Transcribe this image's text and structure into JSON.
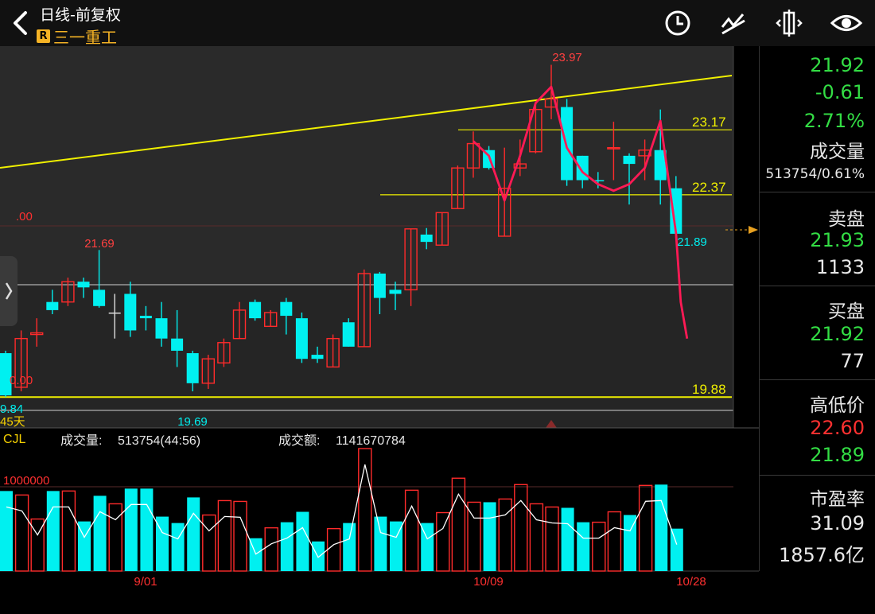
{
  "header": {
    "title": "日线-前复权",
    "badge": "R",
    "stock_name": "三一重工",
    "icons": [
      "back-arrow-icon",
      "clock-icon",
      "draw-line-icon",
      "crosshair-icon",
      "eye-icon"
    ]
  },
  "colors": {
    "up": "#ff2b2b",
    "down": "#00f0f0",
    "trendline": "#f0f000",
    "ma_line": "#ff1a55",
    "price_green": "#33dd44",
    "price_red": "#ff3030"
  },
  "chart_data": [
    {
      "type": "candlestick",
      "title": "日线-前复权",
      "ylim": [
        19.5,
        24.2
      ],
      "price_labels": {
        "high": "23.97",
        "left_high": "21.69",
        "low": "19.69",
        "last": "21.89",
        "left_low": "9.84",
        "left_top": ".00",
        "left_bottom": "0.00"
      },
      "levels": [
        {
          "label": "23.17",
          "value": 23.17
        },
        {
          "label": "22.37",
          "value": 22.37
        },
        {
          "label": "19.88",
          "value": 19.88
        }
      ],
      "period_label": "45天",
      "candles": [
        {
          "o": 19.9,
          "c": 20.42,
          "h": 20.45,
          "l": 19.88,
          "d": "down"
        },
        {
          "o": 20.0,
          "c": 20.6,
          "h": 20.7,
          "l": 19.95,
          "d": "up"
        },
        {
          "o": 20.65,
          "c": 20.67,
          "h": 20.85,
          "l": 20.5,
          "d": "up"
        },
        {
          "o": 20.95,
          "c": 21.05,
          "h": 21.2,
          "l": 20.9,
          "d": "down"
        },
        {
          "o": 21.05,
          "c": 21.3,
          "h": 21.35,
          "l": 21.0,
          "d": "up"
        },
        {
          "o": 21.3,
          "c": 21.23,
          "h": 21.35,
          "l": 21.1,
          "d": "down"
        },
        {
          "o": 21.2,
          "c": 21.0,
          "h": 21.69,
          "l": 20.98,
          "d": "down"
        },
        {
          "o": 20.92,
          "c": 20.92,
          "h": 21.15,
          "l": 20.6,
          "d": "flat"
        },
        {
          "o": 21.15,
          "c": 20.7,
          "h": 21.3,
          "l": 20.62,
          "d": "down"
        },
        {
          "o": 20.88,
          "c": 20.85,
          "h": 21.0,
          "l": 20.7,
          "d": "down"
        },
        {
          "o": 20.85,
          "c": 20.6,
          "h": 21.05,
          "l": 20.5,
          "d": "down"
        },
        {
          "o": 20.6,
          "c": 20.45,
          "h": 20.95,
          "l": 20.25,
          "d": "down"
        },
        {
          "o": 20.05,
          "c": 20.42,
          "h": 20.45,
          "l": 19.95,
          "d": "down"
        },
        {
          "o": 20.05,
          "c": 20.35,
          "h": 20.4,
          "l": 19.98,
          "d": "up"
        },
        {
          "o": 20.3,
          "c": 20.55,
          "h": 20.6,
          "l": 20.25,
          "d": "up"
        },
        {
          "o": 20.6,
          "c": 20.95,
          "h": 21.05,
          "l": 20.6,
          "d": "up"
        },
        {
          "o": 21.05,
          "c": 20.85,
          "h": 21.08,
          "l": 20.82,
          "d": "down"
        },
        {
          "o": 20.75,
          "c": 20.92,
          "h": 20.95,
          "l": 20.75,
          "d": "up"
        },
        {
          "o": 21.05,
          "c": 20.88,
          "h": 21.1,
          "l": 20.65,
          "d": "down"
        },
        {
          "o": 20.85,
          "c": 20.35,
          "h": 20.92,
          "l": 20.3,
          "d": "down"
        },
        {
          "o": 20.35,
          "c": 20.4,
          "h": 20.5,
          "l": 20.3,
          "d": "down"
        },
        {
          "o": 20.25,
          "c": 20.6,
          "h": 20.65,
          "l": 20.25,
          "d": "up"
        },
        {
          "o": 20.8,
          "c": 20.5,
          "h": 20.85,
          "l": 20.5,
          "d": "down"
        },
        {
          "o": 20.5,
          "c": 21.4,
          "h": 21.45,
          "l": 20.5,
          "d": "up"
        },
        {
          "o": 21.4,
          "c": 21.1,
          "h": 21.42,
          "l": 20.9,
          "d": "down"
        },
        {
          "o": 21.15,
          "c": 21.2,
          "h": 21.3,
          "l": 20.95,
          "d": "down"
        },
        {
          "o": 21.2,
          "c": 21.95,
          "h": 21.95,
          "l": 21.0,
          "d": "up"
        },
        {
          "o": 21.88,
          "c": 21.79,
          "h": 21.96,
          "l": 21.7,
          "d": "down"
        },
        {
          "o": 21.75,
          "c": 22.15,
          "h": 22.15,
          "l": 21.75,
          "d": "up"
        },
        {
          "o": 22.2,
          "c": 22.7,
          "h": 22.73,
          "l": 22.2,
          "d": "up"
        },
        {
          "o": 22.7,
          "c": 23.0,
          "h": 23.15,
          "l": 22.58,
          "d": "up"
        },
        {
          "o": 22.92,
          "c": 22.7,
          "h": 22.97,
          "l": 22.68,
          "d": "down"
        },
        {
          "o": 21.86,
          "c": 22.45,
          "h": 22.95,
          "l": 21.86,
          "d": "up"
        },
        {
          "o": 22.7,
          "c": 22.75,
          "h": 23.05,
          "l": 22.6,
          "d": "up"
        },
        {
          "o": 22.9,
          "c": 23.42,
          "h": 23.48,
          "l": 22.88,
          "d": "up"
        },
        {
          "o": 23.45,
          "c": 23.55,
          "h": 23.97,
          "l": 23.3,
          "d": "up"
        },
        {
          "o": 23.45,
          "c": 22.55,
          "h": 23.55,
          "l": 22.48,
          "d": "down"
        },
        {
          "o": 22.85,
          "c": 22.55,
          "h": 22.85,
          "l": 22.45,
          "d": "down"
        },
        {
          "o": 22.55,
          "c": 22.55,
          "h": 22.65,
          "l": 22.45,
          "d": "down"
        },
        {
          "o": 22.95,
          "c": 22.95,
          "h": 23.27,
          "l": 22.55,
          "d": "up"
        },
        {
          "o": 22.85,
          "c": 22.75,
          "h": 22.88,
          "l": 22.25,
          "d": "down"
        },
        {
          "o": 22.85,
          "c": 22.92,
          "h": 23.05,
          "l": 22.55,
          "d": "up"
        },
        {
          "o": 22.92,
          "c": 22.55,
          "h": 23.42,
          "l": 22.25,
          "d": "down"
        },
        {
          "o": 22.45,
          "c": 21.89,
          "h": 22.6,
          "l": 21.89,
          "d": "down"
        }
      ]
    },
    {
      "type": "bar",
      "title": "成交量",
      "header": {
        "indicator": "CJL",
        "volume_label": "成交量:",
        "volume_value": "513754(44:56)",
        "amount_label": "成交额:",
        "amount_value": "1141670784",
        "scale_label": "1000000"
      },
      "ylim": [
        0,
        1550000
      ],
      "x_ticks": [
        "9/01",
        "10/09",
        "10/28"
      ],
      "volumes": [
        {
          "v": 1000000,
          "d": "down"
        },
        {
          "v": 950000,
          "d": "up"
        },
        {
          "v": 650000,
          "d": "up"
        },
        {
          "v": 1000000,
          "d": "down"
        },
        {
          "v": 1000000,
          "d": "up"
        },
        {
          "v": 620000,
          "d": "down"
        },
        {
          "v": 940000,
          "d": "down"
        },
        {
          "v": 840000,
          "d": "up"
        },
        {
          "v": 1030000,
          "d": "down"
        },
        {
          "v": 1030000,
          "d": "down"
        },
        {
          "v": 680000,
          "d": "down"
        },
        {
          "v": 600000,
          "d": "down"
        },
        {
          "v": 920000,
          "d": "down"
        },
        {
          "v": 700000,
          "d": "up"
        },
        {
          "v": 880000,
          "d": "up"
        },
        {
          "v": 870000,
          "d": "up"
        },
        {
          "v": 410000,
          "d": "down"
        },
        {
          "v": 540000,
          "d": "up"
        },
        {
          "v": 610000,
          "d": "down"
        },
        {
          "v": 740000,
          "d": "down"
        },
        {
          "v": 370000,
          "d": "down"
        },
        {
          "v": 530000,
          "d": "up"
        },
        {
          "v": 600000,
          "d": "down"
        },
        {
          "v": 1530000,
          "d": "up"
        },
        {
          "v": 680000,
          "d": "down"
        },
        {
          "v": 620000,
          "d": "down"
        },
        {
          "v": 1010000,
          "d": "up"
        },
        {
          "v": 600000,
          "d": "down"
        },
        {
          "v": 730000,
          "d": "up"
        },
        {
          "v": 1160000,
          "d": "up"
        },
        {
          "v": 860000,
          "d": "up"
        },
        {
          "v": 860000,
          "d": "down"
        },
        {
          "v": 900000,
          "d": "up"
        },
        {
          "v": 1080000,
          "d": "up"
        },
        {
          "v": 840000,
          "d": "up"
        },
        {
          "v": 800000,
          "d": "up"
        },
        {
          "v": 790000,
          "d": "down"
        },
        {
          "v": 610000,
          "d": "down"
        },
        {
          "v": 610000,
          "d": "up"
        },
        {
          "v": 740000,
          "d": "up"
        },
        {
          "v": 700000,
          "d": "down"
        },
        {
          "v": 1070000,
          "d": "up"
        },
        {
          "v": 1080000,
          "d": "down"
        },
        {
          "v": 530000,
          "d": "down"
        }
      ]
    }
  ],
  "sidebar": {
    "price": "21.92",
    "change": "-0.61",
    "change_pct": "2.71%",
    "volume_label": "成交量",
    "volume_value": "513754/0.61%",
    "ask_label": "卖盘",
    "ask_price": "21.93",
    "ask_qty": "1133",
    "bid_label": "买盘",
    "bid_price": "21.92",
    "bid_qty": "77",
    "hl_label": "高低价",
    "high": "22.60",
    "low": "21.89",
    "pe_label": "市盈率",
    "pe_value": "31.09",
    "market_cap": "1857.6亿"
  }
}
